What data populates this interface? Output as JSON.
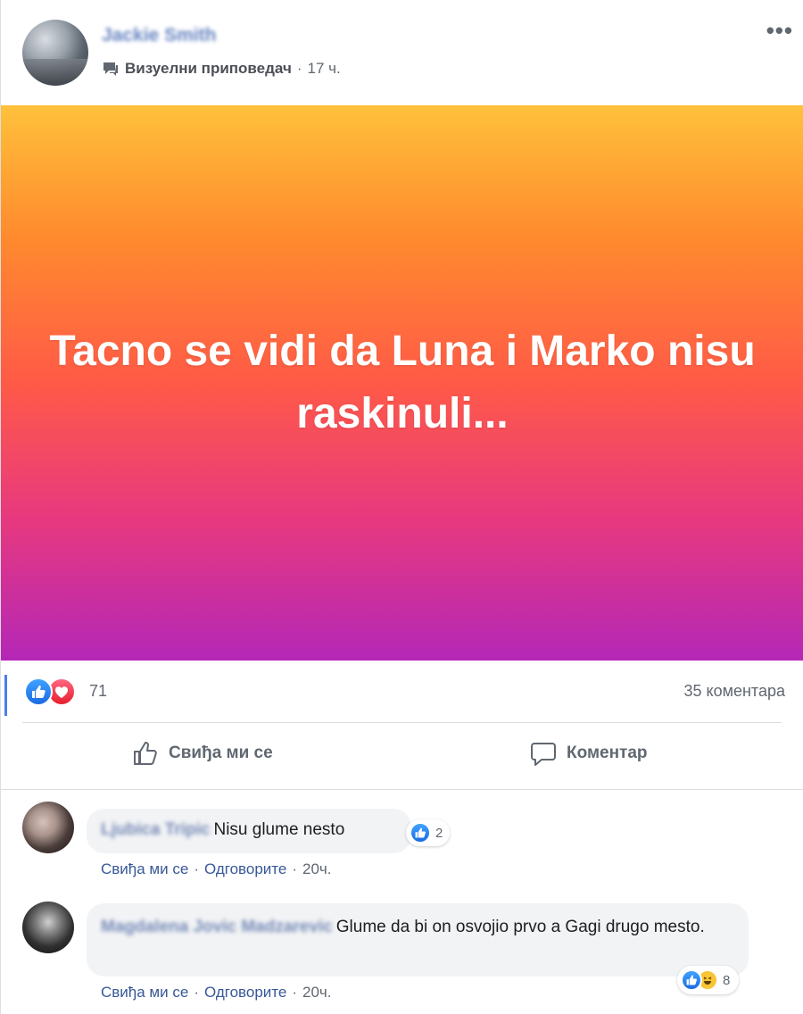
{
  "post": {
    "author": "Jackie Smith",
    "storyteller_label": "Визуелни приповедач",
    "time": "17 ч.",
    "text": "Tacno se vidi da Luna i Marko nisu raskinuli...",
    "reaction_count": "71",
    "comment_count": "35 коментара",
    "like_label": "Свиђа ми се",
    "comment_label": "Коментар",
    "gradient_colors": [
      "#ffc13b",
      "#ff5a47",
      "#b427b7"
    ]
  },
  "comments": [
    {
      "author": "Ljubica Tripic",
      "text": "Nisu glume nesto",
      "reaction_count": "2",
      "like": "Свиђа ми се",
      "reply": "Одговорите",
      "time": "20ч."
    },
    {
      "author": "Magdalena Jovic Madzarevic",
      "text": "Glume da bi on osvojio prvo a Gagi drugo mesto.",
      "reaction_count": "8",
      "like": "Свиђа ми се",
      "reply": "Одговорите",
      "time": "20ч."
    }
  ],
  "icons": {
    "more": "more-options-icon",
    "storyteller": "storyteller-badge-icon",
    "like_reaction": "like-reaction-icon",
    "love_reaction": "love-reaction-icon",
    "haha_reaction": "haha-reaction-icon",
    "like_action": "thumbs-up-icon",
    "comment_action": "speech-bubble-icon"
  }
}
